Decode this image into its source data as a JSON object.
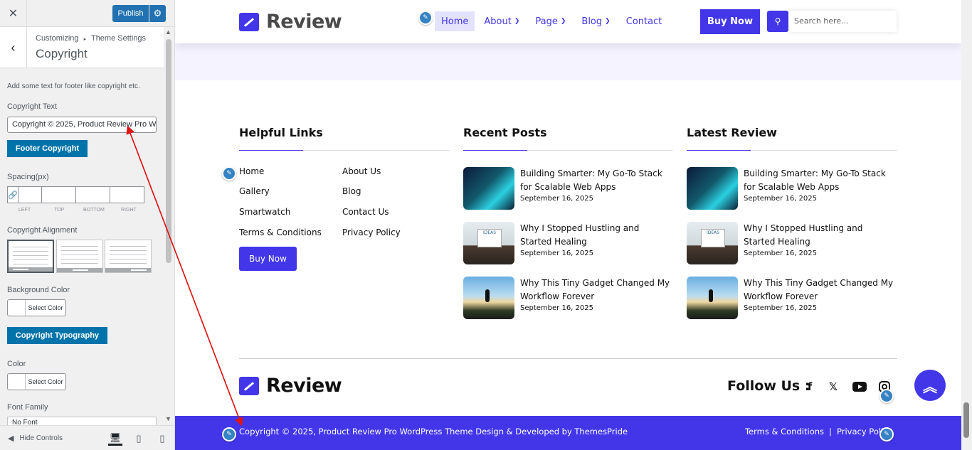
{
  "customizer": {
    "close_label": "✕",
    "publish_label": "Publish",
    "breadcrumb_root": "Customizing",
    "breadcrumb_sep": "▸",
    "breadcrumb_section": "Theme Settings",
    "section_title": "Copyright",
    "description": "Add some text for footer like copyright etc.",
    "copyright_text_label": "Copyright Text",
    "copyright_text_value": "Copyright © 2025, Product Review Pro WordPress Theme Design & Developed by ThemesPride",
    "footer_copyright_button": "Footer Copyright",
    "spacing_label": "Spacing(px)",
    "spacing_sides": [
      "LEFT",
      "TOP",
      "BOTTOM",
      "RIGHT"
    ],
    "alignment_label": "Copyright Alignment",
    "background_color_label": "Background Color",
    "select_color_label": "Select Color",
    "typography_button": "Copyright Typography",
    "color_label": "Color",
    "font_family_label": "Font Family",
    "font_family_value": "No Font",
    "hide_controls_label": "Hide Controls"
  },
  "site": {
    "logo_text": "Review",
    "nav": [
      {
        "label": "Home",
        "active": true,
        "dropdown": false
      },
      {
        "label": "About",
        "active": false,
        "dropdown": true
      },
      {
        "label": "Page",
        "active": false,
        "dropdown": true
      },
      {
        "label": "Blog",
        "active": false,
        "dropdown": true
      },
      {
        "label": "Contact",
        "active": false,
        "dropdown": false
      }
    ],
    "buy_now": "Buy Now",
    "search_placeholder": "Search here..."
  },
  "footer": {
    "helpful_links_title": "Helpful Links",
    "recent_posts_title": "Recent Posts",
    "latest_review_title": "Latest Review",
    "links_col1": [
      "Home",
      "Gallery",
      "Smartwatch",
      "Terms & Conditions"
    ],
    "links_col2": [
      "About Us",
      "Blog",
      "Contact Us",
      "Privacy Policy"
    ],
    "buy_now": "Buy Now",
    "posts": [
      {
        "title": "Building Smarter: My Go-To Stack for Scalable Web Apps",
        "date": "September 16, 2025"
      },
      {
        "title": "Why I Stopped Hustling and Started Healing",
        "date": "September 16, 2025"
      },
      {
        "title": "Why This Tiny Gadget Changed My Workflow Forever",
        "date": "September 16, 2025"
      }
    ],
    "thumb_badge": "IDEAS",
    "follow_us": "Follow Us :",
    "copyright": "Copyright © 2025, Product Review Pro WordPress Theme Design & Developed by ThemesPride",
    "terms_link": "Terms & Conditions",
    "separator": "|",
    "privacy_link": "Privacy Policy"
  },
  "colors": {
    "brand": "#4236e8",
    "wp_blue": "#2271b1",
    "button_blue": "#0073aa",
    "annotation_red": "#e01414"
  },
  "icons": [
    "close-icon",
    "gear-icon",
    "back-arrow-icon",
    "link-icon",
    "desktop-icon",
    "tablet-icon",
    "mobile-icon",
    "pencil-icon",
    "search-icon",
    "facebook-icon",
    "x-icon",
    "youtube-icon",
    "instagram-icon",
    "double-chevron-up-icon"
  ]
}
